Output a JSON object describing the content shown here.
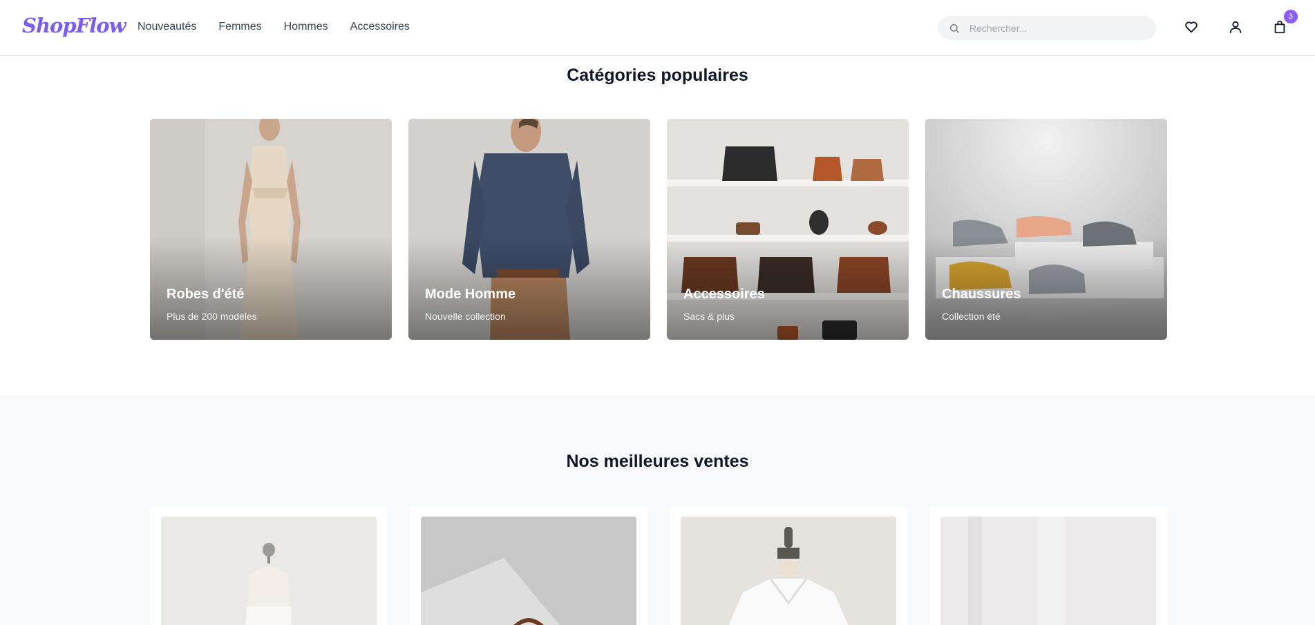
{
  "header": {
    "logo": "ShopFlow",
    "nav": [
      "Nouveautés",
      "Femmes",
      "Hommes",
      "Accessoires"
    ],
    "search_placeholder": "Rechercher...",
    "cart_count": "3"
  },
  "categories": {
    "title": "Catégories populaires",
    "items": [
      {
        "name": "Robes d'été",
        "subtitle": "Plus de 200 modèles"
      },
      {
        "name": "Mode Homme",
        "subtitle": "Nouvelle collection"
      },
      {
        "name": "Accessoires",
        "subtitle": "Sacs & plus"
      },
      {
        "name": "Chaussures",
        "subtitle": "Collection été"
      }
    ]
  },
  "bestsellers": {
    "title": "Nos meilleures ventes"
  },
  "colors": {
    "brand": "#7c5cf0",
    "badge": "#8b5cf6",
    "section_bg": "#f8f9fb"
  }
}
